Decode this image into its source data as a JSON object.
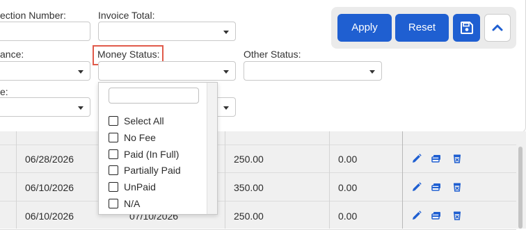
{
  "filters": {
    "collection_number_label": "ection Number:",
    "invoice_total_label": "Invoice Total:",
    "balance_label": "ance:",
    "money_status_label": "Money Status:",
    "other_status_label": "Other Status:",
    "type_label": "e:"
  },
  "buttons": {
    "apply": "Apply",
    "reset": "Reset",
    "save_icon": "save-icon",
    "collapse_icon": "chevron-up-icon"
  },
  "money_status_options": [
    {
      "label": "Select All",
      "checked": false
    },
    {
      "label": "No Fee",
      "checked": false
    },
    {
      "label": "Paid (In Full)",
      "checked": false
    },
    {
      "label": "Partially Paid",
      "checked": false
    },
    {
      "label": "UnPaid",
      "checked": false
    },
    {
      "label": "N/A",
      "checked": false
    }
  ],
  "table": {
    "rows": [
      {
        "date1": "06/28/2026",
        "date2": "",
        "amount": "250.00",
        "balance": "0.00"
      },
      {
        "date1": "06/10/2026",
        "date2": "",
        "amount": "350.00",
        "balance": "0.00"
      },
      {
        "date1": "06/10/2026",
        "date2": "07/10/2026",
        "amount": "250.00",
        "balance": "0.00"
      }
    ],
    "row_actions": [
      "edit-icon",
      "payment-icon",
      "delete-icon"
    ]
  },
  "colors": {
    "primary": "#1f5fd1",
    "highlight": "#e05a4a"
  }
}
